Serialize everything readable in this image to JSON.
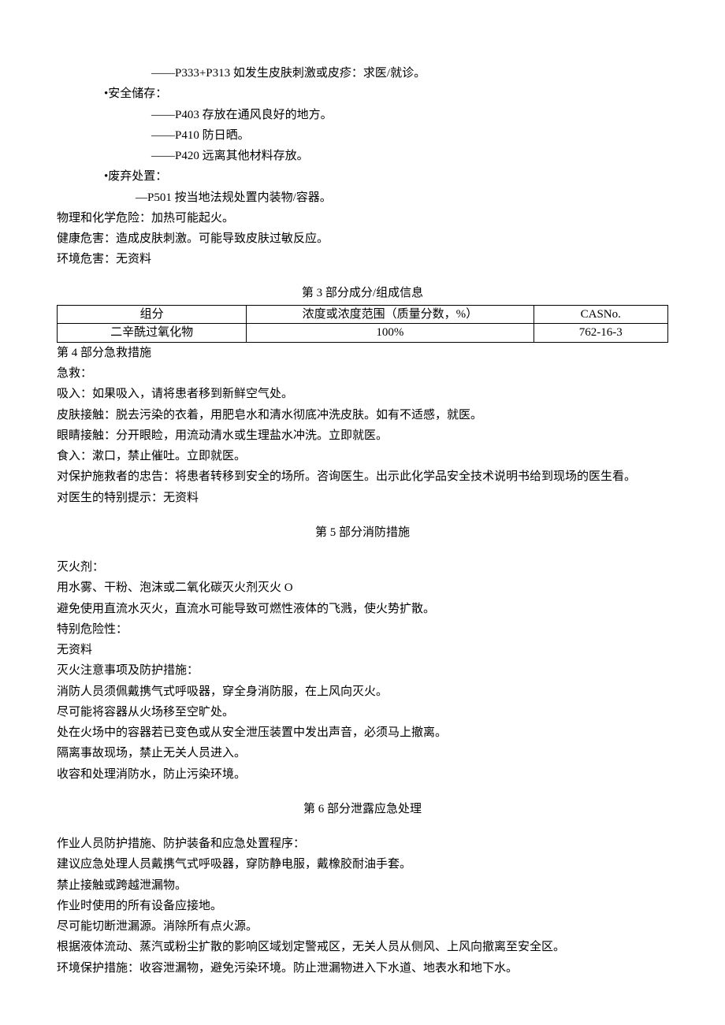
{
  "response": {
    "p333_313": "——P333+P313 如发生皮肤刺激或皮疹：求医/就诊。",
    "storage_header": "•安全储存：",
    "p403": "——P403 存放在通风良好的地方。",
    "p410": "——P410 防日晒。",
    "p420": "——P420 远离其他材料存放。",
    "disposal_header": "•废弃处置：",
    "p501": "—P501 按当地法规处置内装物/容器。"
  },
  "hazards": {
    "physchem": "物理和化学危险：加热可能起火。",
    "health": "健康危害：造成皮肤刺激。可能导致皮肤过敏反应。",
    "env": "环境危害：无资料"
  },
  "section3": {
    "title": "第 3 部分成分/组成信息",
    "headers": {
      "component": "组分",
      "conc": "浓度或浓度范围（质量分数，%）",
      "cas": "CASNo."
    },
    "row": {
      "component": "二辛酰过氧化物",
      "conc": "100%",
      "cas": "762-16-3"
    }
  },
  "section4": {
    "title": "第 4 部分急救措施",
    "first_aid": "急救：",
    "inhale": "吸入：如果吸入，请将患者移到新鲜空气处。",
    "skin": "皮肤接触：脱去污染的衣着，用肥皂水和清水彻底冲洗皮肤。如有不适感，就医。",
    "eyes": "眼睛接触：分开眼睑，用流动清水或生理盐水冲洗。立即就医。",
    "ingest": "食入：漱口，禁止催吐。立即就医。",
    "rescuer": "对保护施救者的忠告：将患者转移到安全的场所。咨询医生。出示此化学品安全技术说明书给到现场的医生看。",
    "doctor": "对医生的特别提示：无资料"
  },
  "section5": {
    "title": "第 5 部分消防措施",
    "extinguisher_header": "灭火剂：",
    "extinguisher": "用水雾、干粉、泡沫或二氧化碳灭火剂灭火 O",
    "avoid": "避免使用直流水灭火，直流水可能导致可燃性液体的飞溅，使火势扩散。",
    "danger_header": "特别危险性：",
    "danger": "无资料",
    "notes_header": "灭火注意事项及防护措施：",
    "n1": "消防人员须佩戴携气式呼吸器，穿全身消防服，在上风向灭火。",
    "n2": "尽可能将容器从火场移至空旷处。",
    "n3": "处在火场中的容器若已变色或从安全泄压装置中发出声音，必须马上撤离。",
    "n4": "隔离事故现场，禁止无关人员进入。",
    "n5": "收容和处理消防水，防止污染环境。"
  },
  "section6": {
    "title": "第 6 部分泄露应急处理",
    "header": "作业人员防护措施、防护装备和应急处置程序：",
    "l1": "建议应急处理人员戴携气式呼吸器，穿防静电服，戴橡胶耐油手套。",
    "l2": "禁止接触或跨越泄漏物。",
    "l3": "作业时使用的所有设备应接地。",
    "l4": "尽可能切断泄漏源。消除所有点火源。",
    "l5": "根据液体流动、蒸汽或粉尘扩散的影响区域划定警戒区，无关人员从侧风、上风向撤离至安全区。",
    "env": "环境保护措施：收容泄漏物，避免污染环境。防止泄漏物进入下水道、地表水和地下水。"
  }
}
